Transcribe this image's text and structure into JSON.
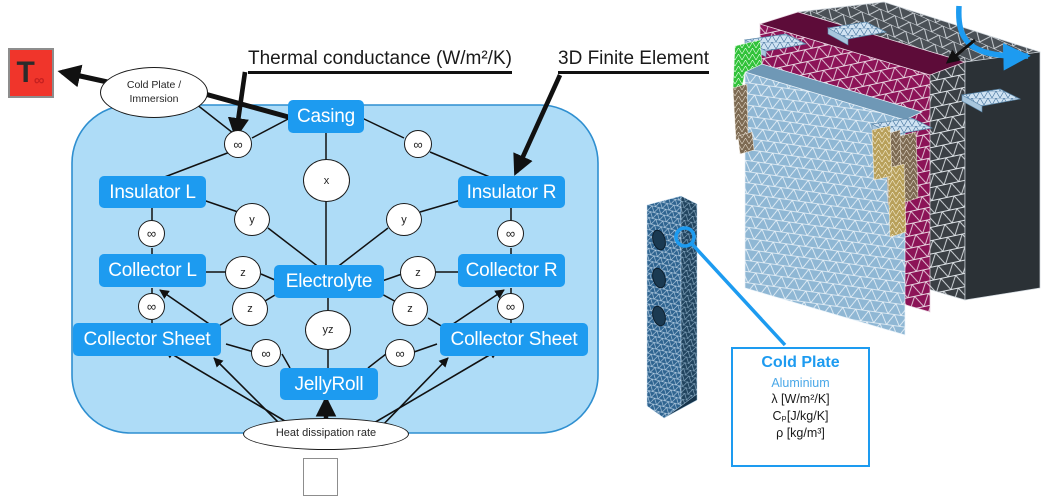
{
  "annotations": {
    "thermal_conductance_label": "Thermal conductance (W/m²/K)",
    "finite_element_label": "3D Finite Element"
  },
  "ambient_badge": {
    "symbol": "T",
    "subscript": "∞",
    "name": "ambient-temperature"
  },
  "boundary": {
    "cold_plate_line1": "Cold Plate /",
    "cold_plate_line2": "Immersion",
    "heat_source": "Heat dissipation rate",
    "heat_source_icon": "flame-q-dot-icon"
  },
  "thermal_network": {
    "blocks": [
      {
        "id": "casing",
        "label": "Casing"
      },
      {
        "id": "insulator-l",
        "label": "Insulator L"
      },
      {
        "id": "insulator-r",
        "label": "Insulator R"
      },
      {
        "id": "collector-l",
        "label": "Collector L"
      },
      {
        "id": "collector-r",
        "label": "Collector R"
      },
      {
        "id": "collector-sheet-l",
        "label": "Collector Sheet"
      },
      {
        "id": "collector-sheet-r",
        "label": "Collector Sheet"
      },
      {
        "id": "electrolyte",
        "label": "Electrolyte"
      },
      {
        "id": "jellyroll",
        "label": "JellyRoll"
      }
    ],
    "conductance_nodes": [
      {
        "id": "g-casing-left",
        "label": "∞"
      },
      {
        "id": "g-casing-right",
        "label": "∞"
      },
      {
        "id": "g-casing-x",
        "label": "x"
      },
      {
        "id": "g-insl-y",
        "label": "y"
      },
      {
        "id": "g-insr-y",
        "label": "y"
      },
      {
        "id": "g-insl-inf",
        "label": "∞"
      },
      {
        "id": "g-insr-inf",
        "label": "∞"
      },
      {
        "id": "g-coll-l-z",
        "label": "z"
      },
      {
        "id": "g-coll-r-z",
        "label": "z"
      },
      {
        "id": "g-sheet-l-z",
        "label": "z"
      },
      {
        "id": "g-sheet-r-z",
        "label": "z"
      },
      {
        "id": "g-coll-l-inf",
        "label": "∞"
      },
      {
        "id": "g-coll-r-inf",
        "label": "∞"
      },
      {
        "id": "g-jelly-yz",
        "label": "yz"
      },
      {
        "id": "g-sheet-l-inf",
        "label": "∞"
      },
      {
        "id": "g-sheet-r-inf",
        "label": "∞"
      }
    ]
  },
  "cold_plate_card": {
    "title": "Cold Plate",
    "material": "Aluminium",
    "lambda": "λ [W/m²/K]",
    "cp": "Cₚ[J/kg/K]",
    "rho": "ρ [kg/m³]"
  },
  "colors": {
    "block_fill": "#1d9bf0",
    "panel_fill": "#aedcf7",
    "panel_stroke": "#2f8fd0",
    "callout_blue": "#1d9bf0",
    "ambient_red": "#f0352b",
    "mesh_blue": "#8fb7d4",
    "mesh_magenta": "#8c1357",
    "mesh_dark": "#3a3f44",
    "mesh_green": "#31c23a",
    "mesh_gold": "#b8a05a"
  },
  "fem_view": {
    "name": "3d-finite-element-mesh",
    "cold_plate_column": "cold-plate-mesh-column",
    "rotation_arrow": "rotation-arrow",
    "pointer_arrow": "pointer-arrow"
  }
}
